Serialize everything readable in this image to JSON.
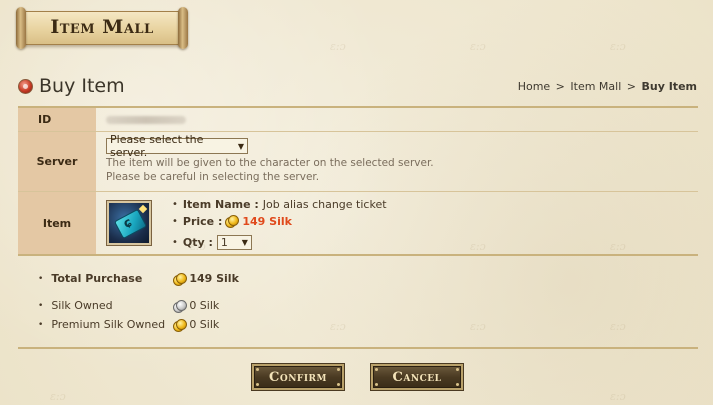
{
  "banner": {
    "title": "Item Mall"
  },
  "heading": {
    "title": "Buy Item"
  },
  "breadcrumb": {
    "items": [
      "Home",
      "Item Mall",
      "Buy Item"
    ],
    "separator": ">"
  },
  "form": {
    "id_label": "ID",
    "server_label": "Server",
    "server_select": {
      "selected": "Please select the server."
    },
    "server_notes": [
      "The item will be given to the character on the selected server.",
      "Please be careful in selecting the server."
    ],
    "item_label": "Item",
    "item_icon": "job-alias-change-ticket-icon",
    "item_name_label": "Item Name :",
    "item_name": "Job alias change ticket",
    "price_label": "Price :",
    "price_value": "149 Silk",
    "qty_label": "Qty :",
    "qty_value": "1"
  },
  "totals": {
    "total_purchase_label": "Total Purchase",
    "total_purchase_value": "149 Silk",
    "silk_owned_label": "Silk Owned",
    "silk_owned_value": "0 Silk",
    "premium_silk_label": "Premium Silk Owned",
    "premium_silk_value": "0 Silk"
  },
  "buttons": {
    "confirm": "Confirm",
    "cancel": "Cancel"
  },
  "colors": {
    "accent_price": "#e0491b",
    "label_bg": "#e4c8a4",
    "rule": "#c9b27d",
    "button_bg": "#4a3a22",
    "background": "#f1ead6"
  }
}
